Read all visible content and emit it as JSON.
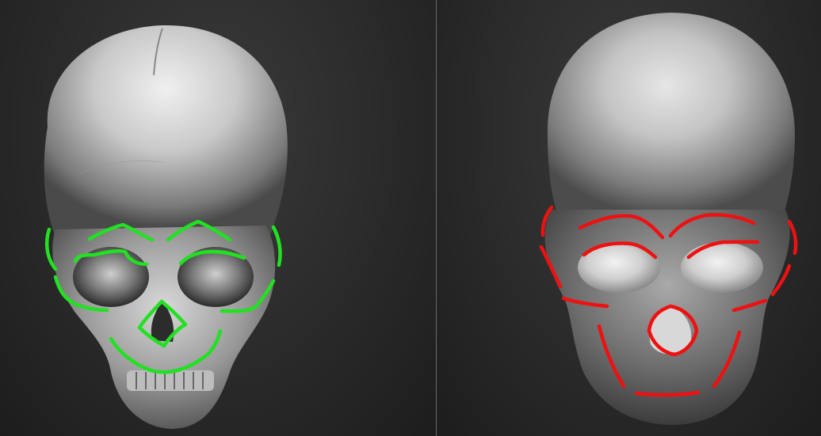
{
  "panels": [
    {
      "id": "left",
      "subject": "detailed-skull-sculpt",
      "outline_color": "#22e022"
    },
    {
      "id": "right",
      "subject": "stylized-skull-sculpt",
      "outline_color": "#ee1111"
    }
  ],
  "colors": {
    "background": "#2a2a2a",
    "divider": "#6a6a6a",
    "skull_light": "#e8e8e8",
    "skull_mid": "#a0a0a0",
    "skull_dark": "#3a3a3a"
  }
}
